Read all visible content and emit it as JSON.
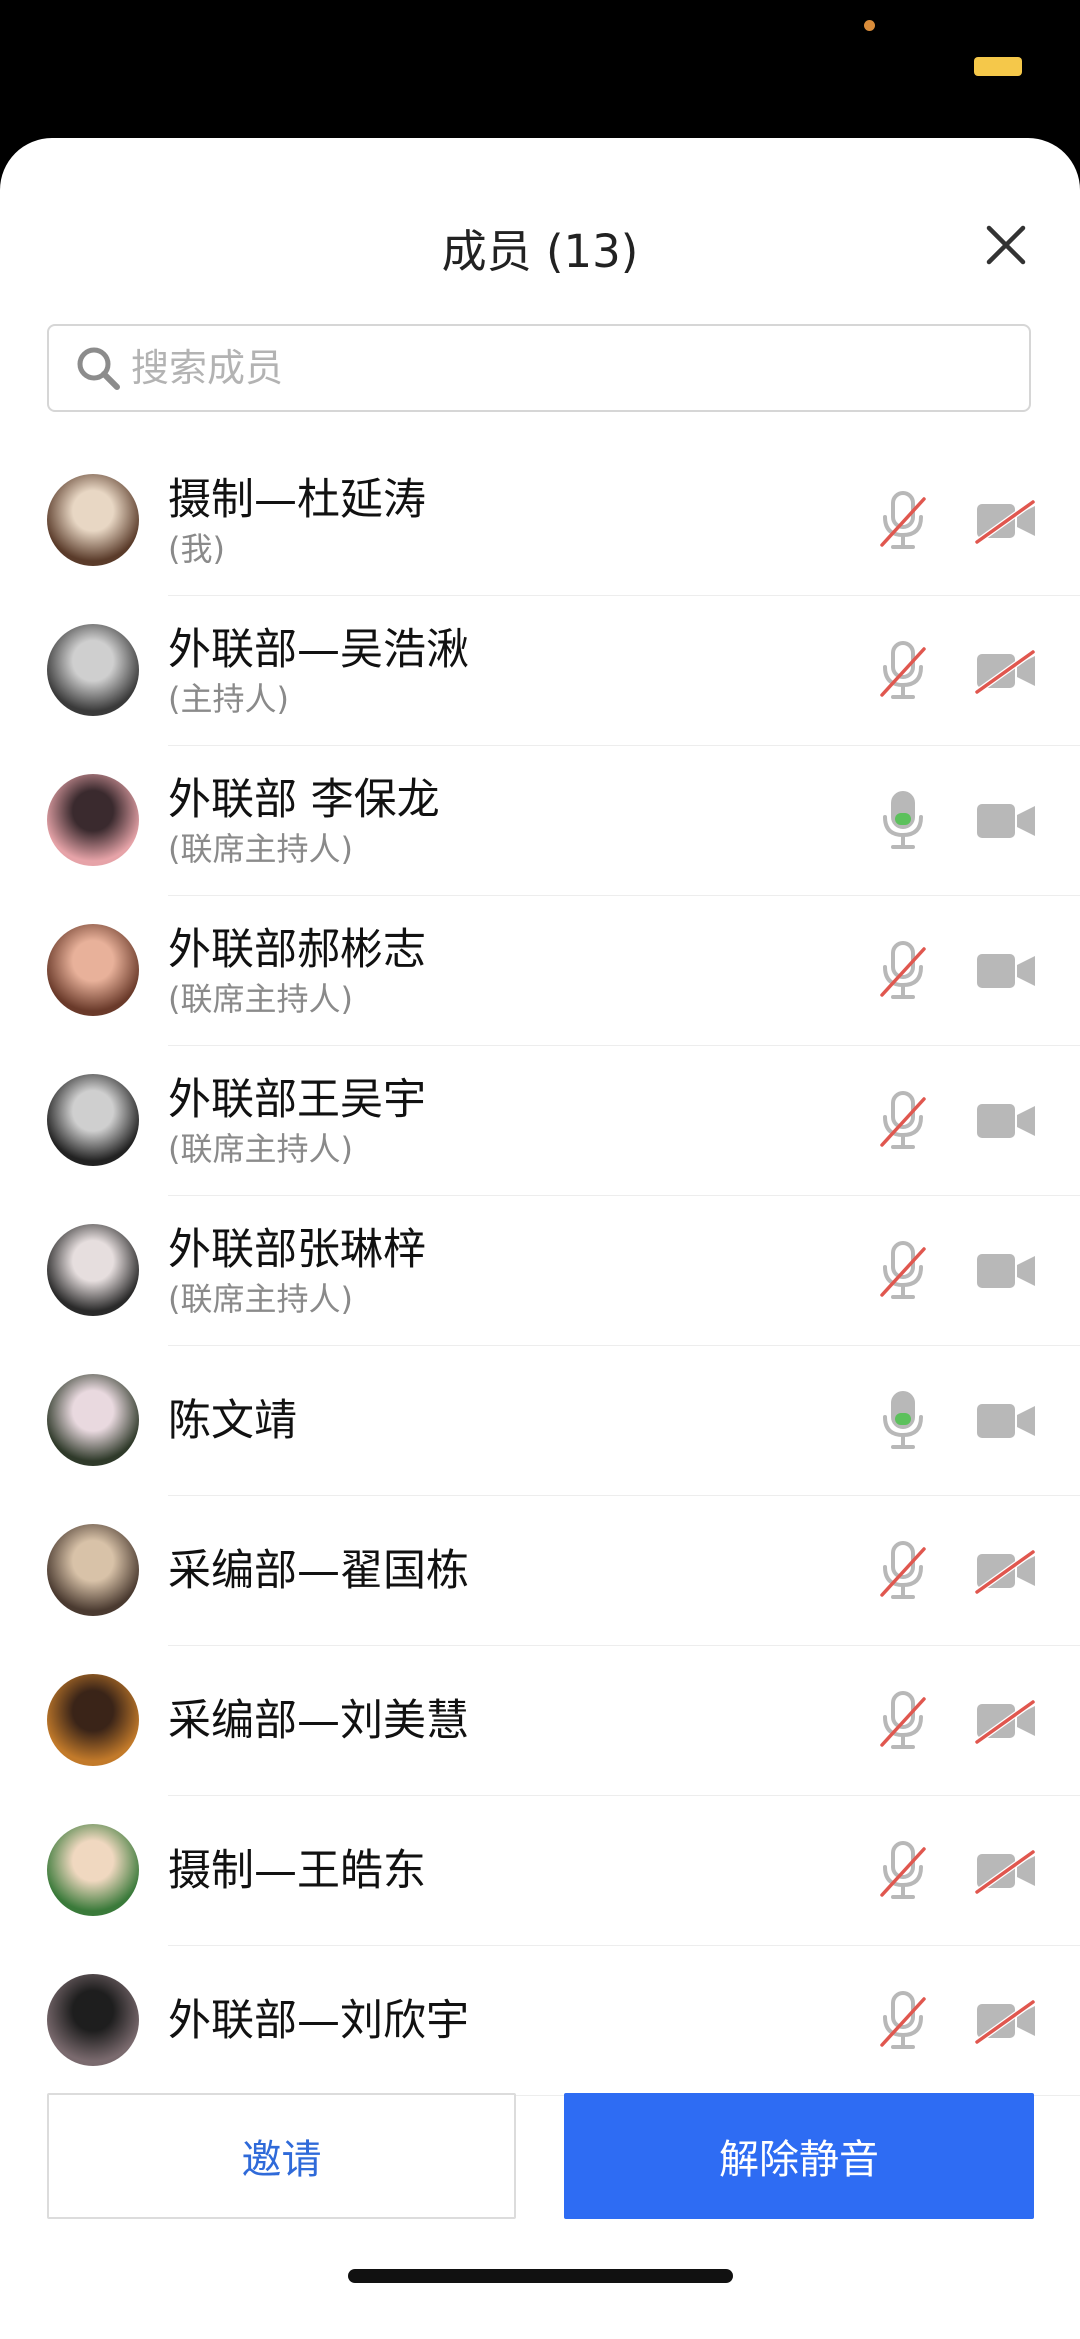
{
  "header": {
    "title": "成员 (13)"
  },
  "search": {
    "placeholder": "搜索成员"
  },
  "members": [
    {
      "name": "摄制—杜延涛",
      "role": "(我)",
      "mic": "muted",
      "camera": "off",
      "avatar_colors": [
        "#5a3b2a",
        "#e8d7c4"
      ]
    },
    {
      "name": "外联部—吴浩湫",
      "role": "(主持人)",
      "mic": "muted",
      "camera": "off",
      "avatar_colors": [
        "#3a3a3a",
        "#cfcfcf"
      ]
    },
    {
      "name": "外联部 李保龙",
      "role": "(联席主持人)",
      "mic": "on",
      "camera": "on",
      "avatar_colors": [
        "#e6a3a8",
        "#3a2a2e"
      ]
    },
    {
      "name": "外联部郝彬志",
      "role": "(联席主持人)",
      "mic": "muted",
      "camera": "on",
      "avatar_colors": [
        "#6a3a2a",
        "#e8b19a"
      ]
    },
    {
      "name": "外联部王吴宇",
      "role": "(联席主持人)",
      "mic": "muted",
      "camera": "on",
      "avatar_colors": [
        "#222222",
        "#cfcfcf"
      ]
    },
    {
      "name": "外联部张琳梓",
      "role": "(联席主持人)",
      "mic": "muted",
      "camera": "on",
      "avatar_colors": [
        "#2a2a2a",
        "#e6dede"
      ]
    },
    {
      "name": "陈文靖",
      "role": "",
      "mic": "on",
      "camera": "on",
      "avatar_colors": [
        "#2f3a2a",
        "#e9d9df"
      ]
    },
    {
      "name": "采编部—翟国栋",
      "role": "",
      "mic": "muted",
      "camera": "off",
      "avatar_colors": [
        "#4a3a30",
        "#d8c2a8"
      ]
    },
    {
      "name": "采编部—刘美慧",
      "role": "",
      "mic": "muted",
      "camera": "off",
      "avatar_colors": [
        "#c27a2a",
        "#3a2418"
      ]
    },
    {
      "name": "摄制—王皓东",
      "role": "",
      "mic": "muted",
      "camera": "off",
      "avatar_colors": [
        "#3a7a3a",
        "#f0d8c0"
      ]
    },
    {
      "name": "外联部—刘欣宇",
      "role": "",
      "mic": "muted",
      "camera": "off",
      "avatar_colors": [
        "#7a6a6e",
        "#1e1e1e"
      ]
    }
  ],
  "footer": {
    "invite_label": "邀请",
    "unmute_label": "解除静音"
  },
  "icons": {
    "search": "search-icon",
    "close": "close-icon",
    "mic_on": "microphone-icon",
    "mic_muted": "microphone-muted-icon",
    "camera_on": "video-camera-icon",
    "camera_off": "video-camera-off-icon"
  },
  "colors": {
    "primary": "#2e6cf3",
    "invite_text": "#2f6ad9",
    "muted_slash": "#e0574f",
    "mic_active": "#5cc15c",
    "icon_gray": "#b8b8b8"
  }
}
